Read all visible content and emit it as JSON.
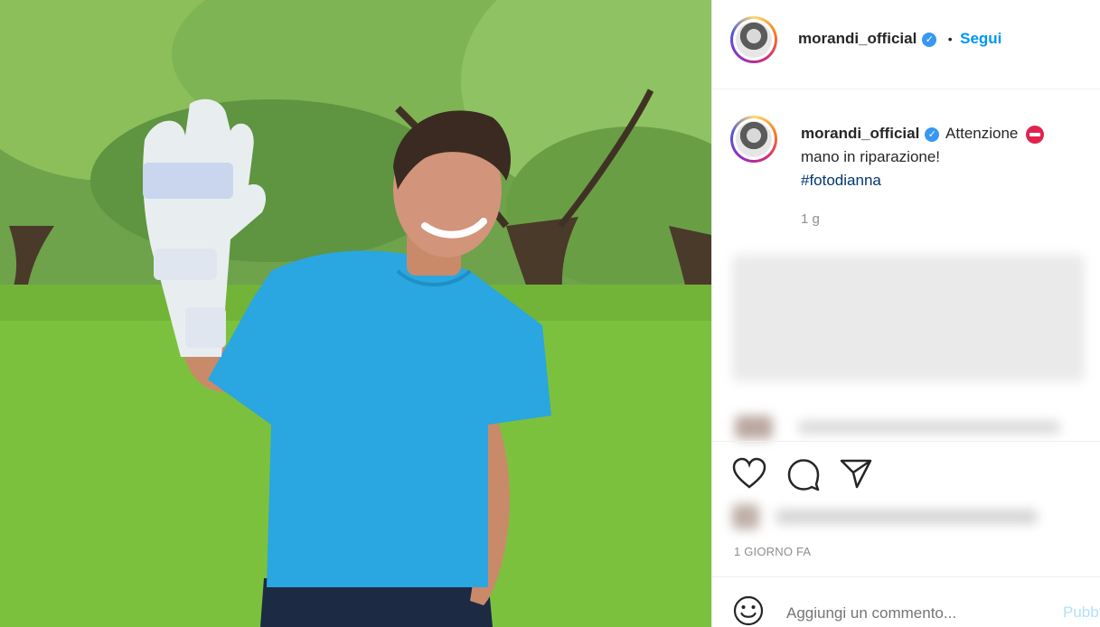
{
  "header": {
    "username": "morandi_official",
    "separator": "•",
    "follow_label": "Segui"
  },
  "caption": {
    "username": "morandi_official",
    "text_line1": "Attenzione",
    "text_line2": "mano in riparazione!",
    "hashtag": "#fotodianna",
    "age": "1 g"
  },
  "actions": {
    "like_icon": "heart-outline",
    "comment_icon": "speech-bubble",
    "share_icon": "paper-plane"
  },
  "timestamp": "1 GIORNO FA",
  "comment_box": {
    "emoji_icon": "smiley",
    "placeholder": "Aggiungi un commento...",
    "publish_label": "Pubblica"
  },
  "colors": {
    "link_blue": "#0095f6",
    "verified_blue": "#3897f0",
    "stop_red": "#e0234e",
    "text": "#262626",
    "muted": "#8e8e8e"
  }
}
